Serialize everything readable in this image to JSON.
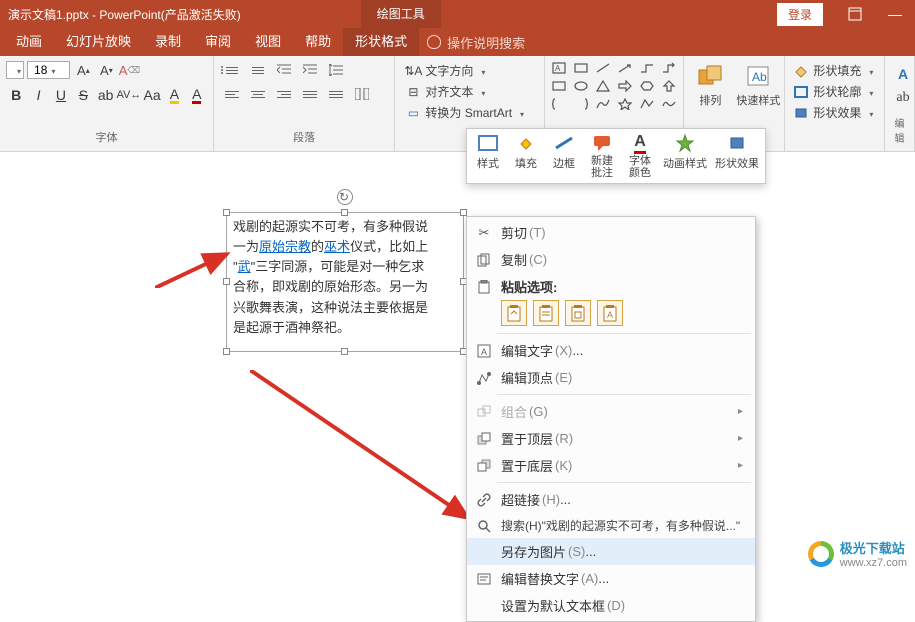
{
  "title": {
    "filename": "演示文稿1.pptx",
    "app": "PowerPoint(产品激活失败)",
    "tool_tab": "绘图工具",
    "login": "登录"
  },
  "tabs": [
    "动画",
    "幻灯片放映",
    "录制",
    "审阅",
    "视图",
    "帮助",
    "形状格式"
  ],
  "tell_me": "操作说明搜索",
  "ribbon": {
    "font_size": "18",
    "group_font": "字体",
    "group_para": "段落",
    "textdir": {
      "dir": "文字方向",
      "align": "对齐文本",
      "smartart": "转换为 SmartArt"
    },
    "arrange": "排列",
    "quick": "快速样式",
    "shape_fill": "形状填充",
    "shape_outline": "形状轮廓",
    "shape_effect": "形状效果",
    "edit_group": "编辑"
  },
  "mini": {
    "style": "样式",
    "fill": "填充",
    "outline": "边框",
    "comment": "新建\n批注",
    "font_color": "字体\n颜色",
    "anim": "动画样式",
    "effect": "形状效果"
  },
  "textbox": {
    "line1a": "戏剧的起源实不可考，有多种假说",
    "line2a": "一为",
    "link1": "原始宗教",
    "line2b": "的",
    "link2": "巫术",
    "line2c": "仪式，比如上",
    "line3a": "\"",
    "link3": "武",
    "line3b": "\"三字同源，可能是对一种乞求",
    "line4": "合称，即戏剧的原始形态。另一为",
    "line5": "兴歌舞表演，这种说法主要依据是",
    "line6": "是起源于酒神祭祀。"
  },
  "ctx": {
    "cut": "剪切",
    "cut_key": "(T)",
    "copy": "复制",
    "copy_key": "(C)",
    "paste_title": "粘贴选项:",
    "edit_text": "编辑文字",
    "edit_text_key": "(X)",
    "edit_points": "编辑顶点",
    "edit_points_key": "(E)",
    "group": "组合",
    "group_key": "(G)",
    "bring_front": "置于顶层",
    "bring_front_key": "(R)",
    "send_back": "置于底层",
    "send_back_key": "(K)",
    "hyperlink": "超链接",
    "hyperlink_key": "(H)",
    "search": "搜索(H)\"戏剧的起源实不可考，有多种假说...\"",
    "save_pic": "另存为图片",
    "save_pic_key": "(S)",
    "alt_text": "编辑替换文字",
    "alt_text_key": "(A)",
    "default": "设置为默认文本框",
    "default_key": "(D)"
  },
  "watermark": {
    "name": "极光下载站",
    "url": "www.xz7.com"
  },
  "chart_data": null
}
